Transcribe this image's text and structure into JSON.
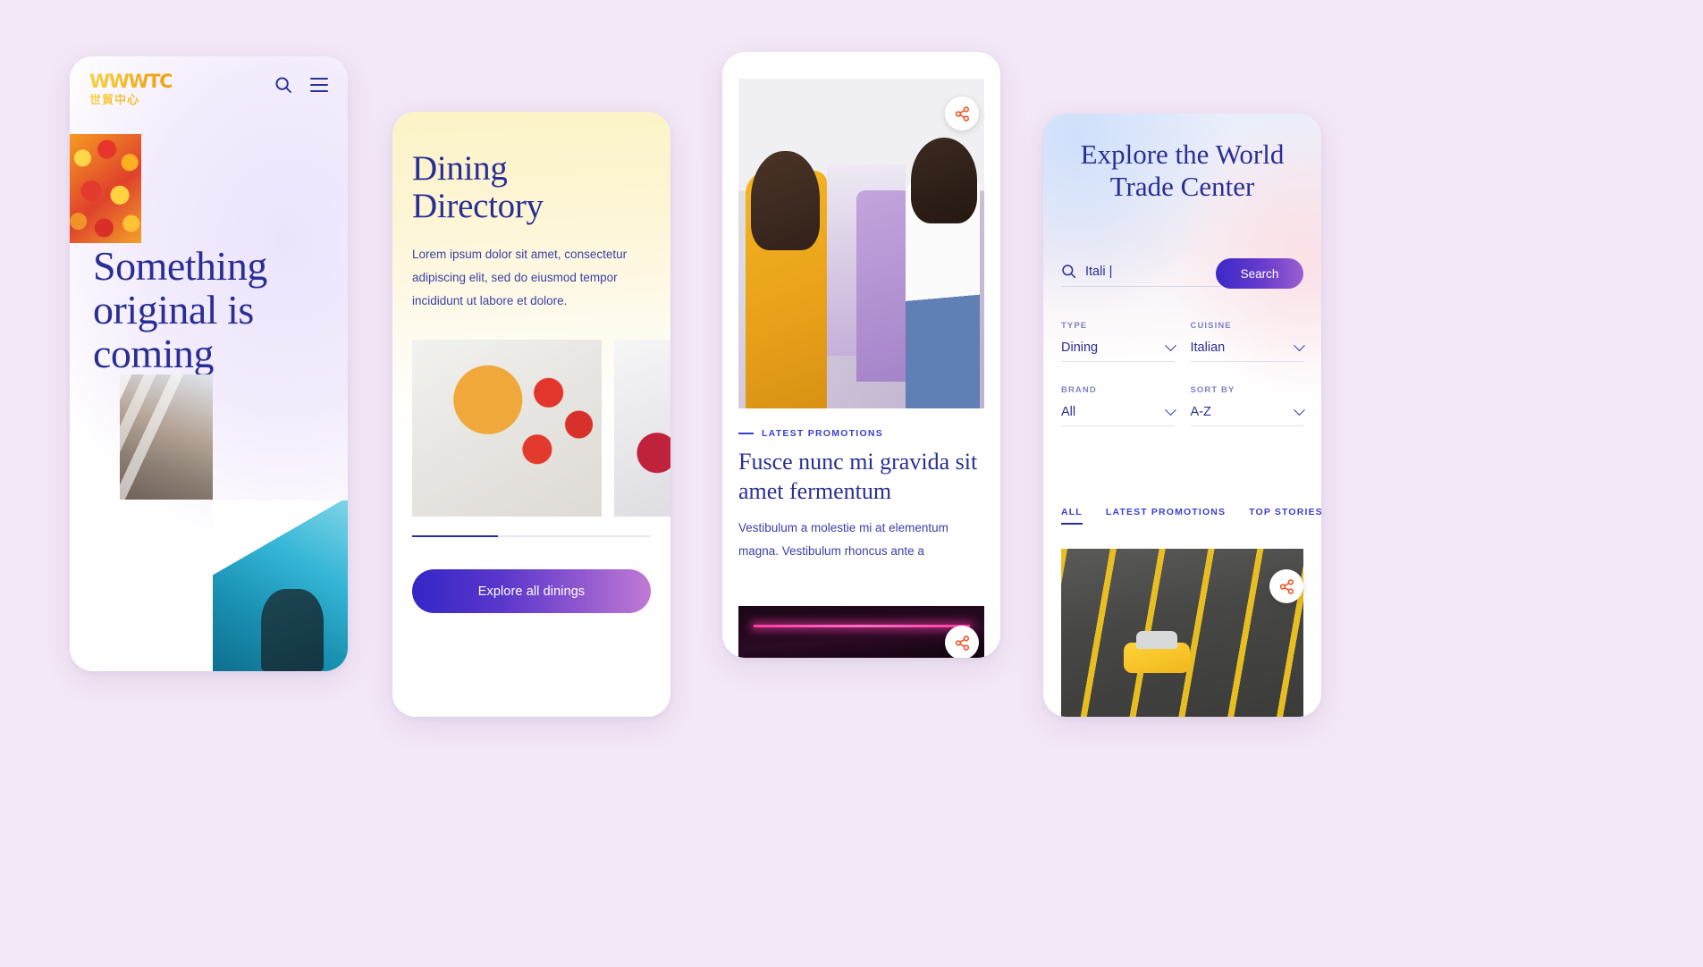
{
  "screen1": {
    "logo": {
      "main": "WWWTC",
      "cn": "世貿中心"
    },
    "icons": {
      "search": "search-icon",
      "menu": "hamburger-menu-icon"
    },
    "headline": "Something original is coming",
    "images": {
      "fruit": "citrus-fruit-photo",
      "mall": "mall-interior-photo",
      "sky": "architecture-sky-photo"
    }
  },
  "screen2": {
    "title": "Dining\nDirectory",
    "body": "Lorem ipsum dolor sit amet, consectetur adipiscing elit, sed do eiusmod tempor incididunt ut labore et dolore.",
    "gallery": [
      {
        "name": "pasta-tomato-photo"
      },
      {
        "name": "dessert-photo"
      }
    ],
    "progress_percent": 36,
    "cta_label": "Explore all dinings"
  },
  "screen3": {
    "hero_image": "clothing-store-shoppers-photo",
    "share_label": "share-icon",
    "eyebrow": "LATEST PROMOTIONS",
    "title": "Fusce nunc mi gravida sit amet fermentum",
    "body": "Vestibulum a molestie mi at elementum magna. Vestibulum rhoncus ante a",
    "hero_image_2": "neon-sign-photo"
  },
  "screen4": {
    "title": "Explore the World Trade Center",
    "search": {
      "value": "Itali",
      "placeholder": "Search",
      "icon": "search-icon"
    },
    "search_button": "Search",
    "filters": [
      {
        "label": "TYPE",
        "value": "Dining"
      },
      {
        "label": "CUISINE",
        "value": "Italian"
      },
      {
        "label": "BRAND",
        "value": "All"
      },
      {
        "label": "SORT BY",
        "value": "A-Z"
      }
    ],
    "tabs": [
      {
        "label": "ALL",
        "active": true
      },
      {
        "label": "LATEST PROMOTIONS",
        "active": false
      },
      {
        "label": "TOP STORIES",
        "active": false
      }
    ],
    "card_image": "parking-lot-yellow-car-photo",
    "share_label": "share-icon"
  },
  "colors": {
    "page_background": "#f3e8f7",
    "ink": "#2a2f94",
    "accent_gradient_start": "#3426c6",
    "accent_gradient_end": "#c07ad4",
    "logo_gold": "#f0ab1b",
    "share_orange": "#f3542a"
  }
}
